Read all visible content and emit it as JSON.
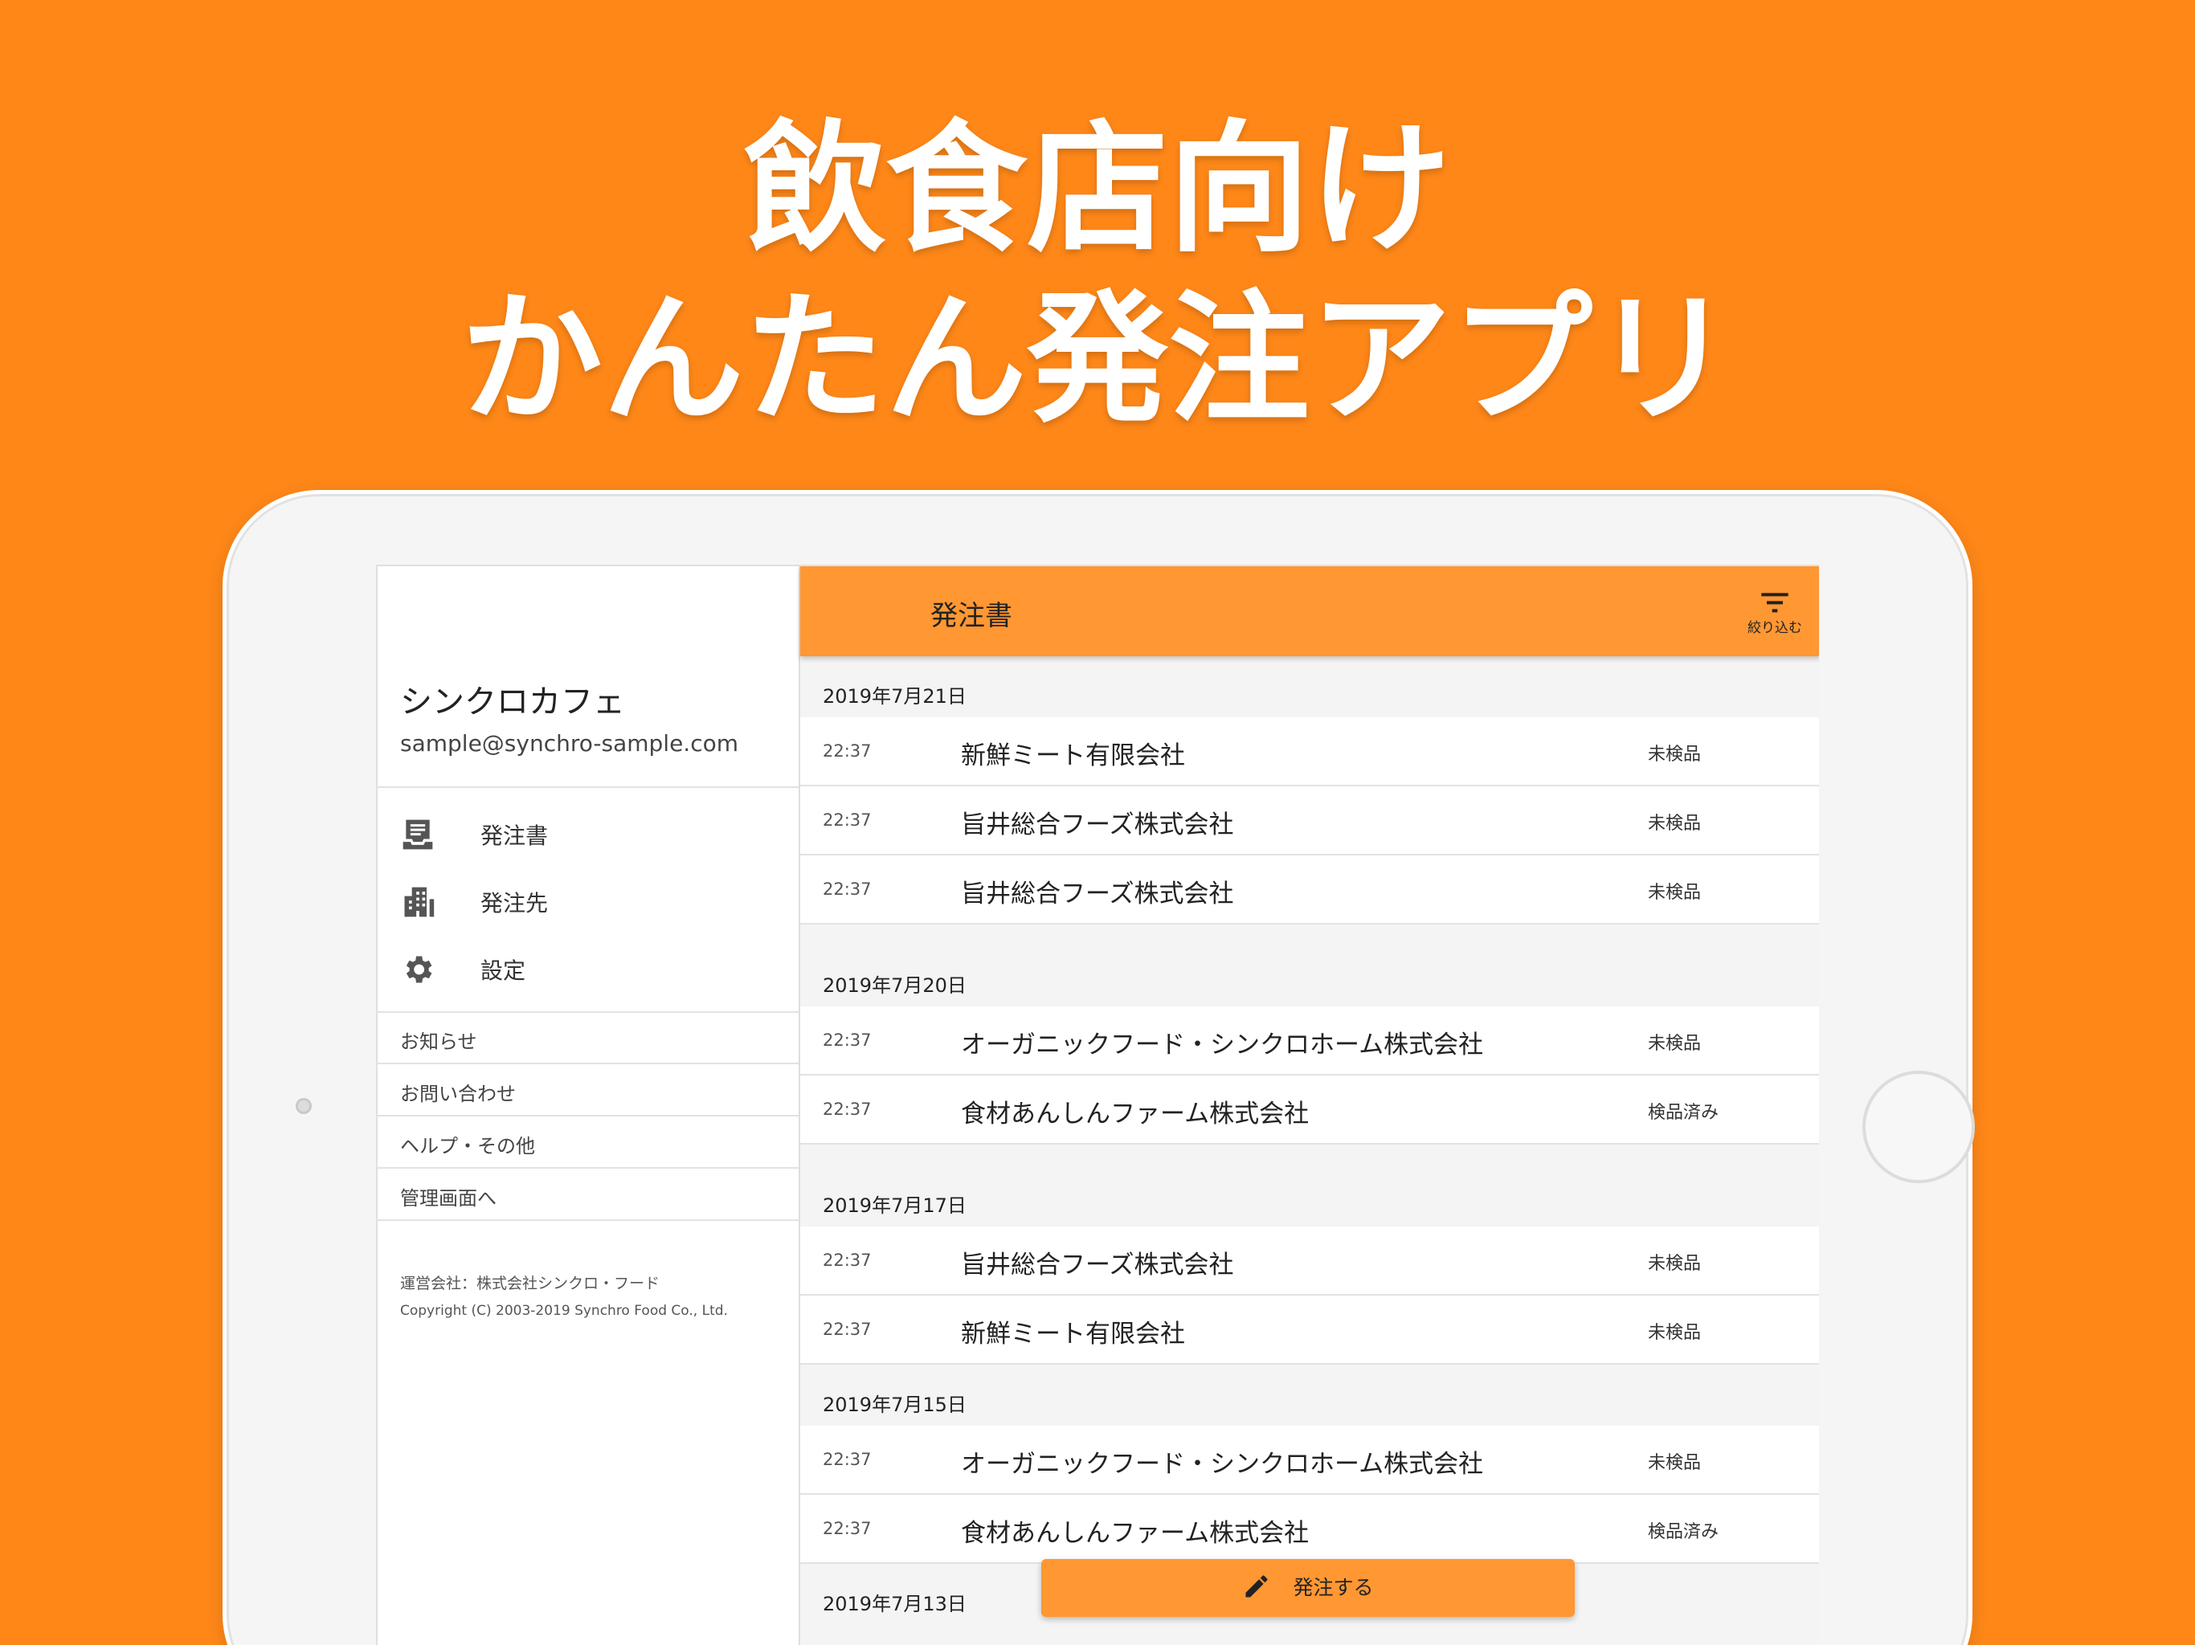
{
  "headline": {
    "line1": "飲食店向け",
    "line2": "かんたん発注アプリ"
  },
  "sidebar": {
    "shop_name": "シンクロカフェ",
    "email": "sample@synchro-sample.com",
    "nav": [
      {
        "label": "発注書",
        "icon": "order-form-icon"
      },
      {
        "label": "発注先",
        "icon": "building-icon"
      },
      {
        "label": "設定",
        "icon": "gear-icon"
      }
    ],
    "links": [
      {
        "label": "お知らせ"
      },
      {
        "label": "お問い合わせ"
      },
      {
        "label": "ヘルプ・その他"
      },
      {
        "label": "管理画面へ"
      }
    ],
    "footer": {
      "company": "運営会社：株式会社シンクロ・フード",
      "copyright": "Copyright (C) 2003-2019 Synchro Food Co., Ltd."
    }
  },
  "appbar": {
    "title": "発注書",
    "filter_label": "絞り込む",
    "filter_icon": "filter-icon"
  },
  "orders": [
    {
      "date": "2019年7月21日",
      "rows": [
        {
          "time": "22:37",
          "vendor": "新鮮ミート有限会社",
          "status": "未検品"
        },
        {
          "time": "22:37",
          "vendor": "旨井総合フーズ株式会社",
          "status": "未検品"
        },
        {
          "time": "22:37",
          "vendor": "旨井総合フーズ株式会社",
          "status": "未検品"
        }
      ]
    },
    {
      "date": "2019年7月20日",
      "rows": [
        {
          "time": "22:37",
          "vendor": "オーガニックフード・シンクロホーム株式会社",
          "status": "未検品"
        },
        {
          "time": "22:37",
          "vendor": "食材あんしんファーム株式会社",
          "status": "検品済み"
        }
      ]
    },
    {
      "date": "2019年7月17日",
      "rows": [
        {
          "time": "22:37",
          "vendor": "旨井総合フーズ株式会社",
          "status": "未検品"
        },
        {
          "time": "22:37",
          "vendor": "新鮮ミート有限会社",
          "status": "未検品"
        }
      ]
    },
    {
      "date": "2019年7月15日",
      "rows": [
        {
          "time": "22:37",
          "vendor": "オーガニックフード・シンクロホーム株式会社",
          "status": "未検品"
        },
        {
          "time": "22:37",
          "vendor": "食材あんしんファーム株式会社",
          "status": "検品済み"
        }
      ]
    },
    {
      "date": "2019年7月13日",
      "rows": []
    }
  ],
  "fab": {
    "label": "発注する",
    "icon": "pencil-icon"
  },
  "colors": {
    "background": "#fe8718",
    "appbar": "#ff9733"
  }
}
